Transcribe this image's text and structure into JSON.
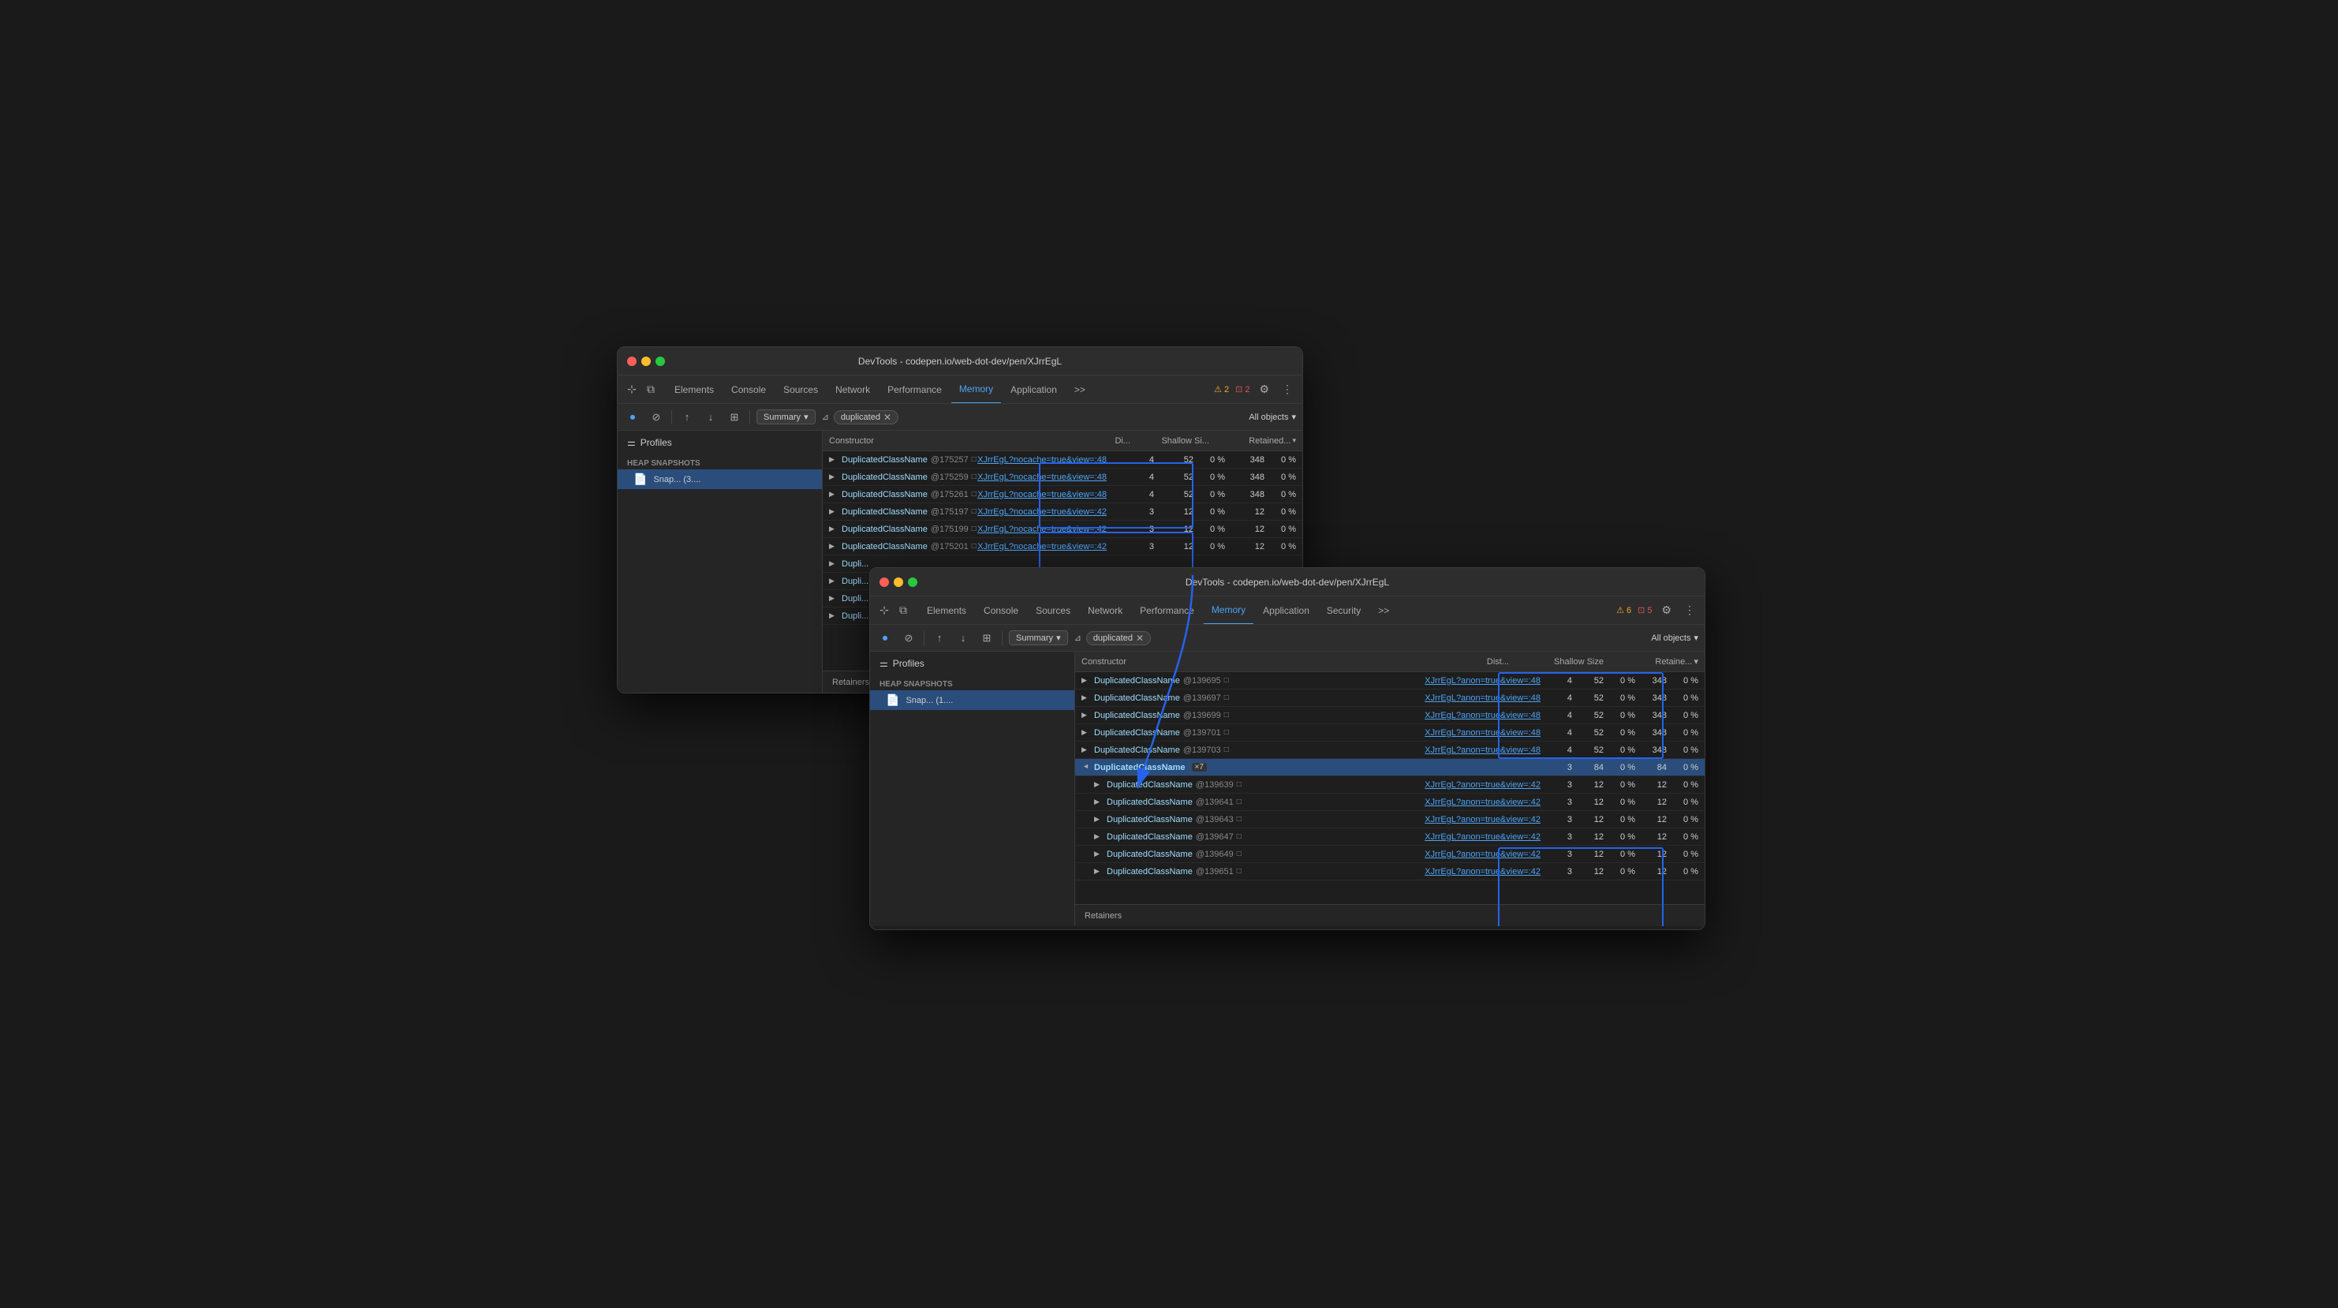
{
  "window1": {
    "title": "DevTools - codepen.io/web-dot-dev/pen/XJrrEgL",
    "tabs": [
      {
        "label": "Elements",
        "active": false
      },
      {
        "label": "Console",
        "active": false
      },
      {
        "label": "Sources",
        "active": false
      },
      {
        "label": "Network",
        "active": false
      },
      {
        "label": "Performance",
        "active": false
      },
      {
        "label": "Memory",
        "active": true
      },
      {
        "label": "Application",
        "active": false
      }
    ],
    "warnings": "2",
    "errors": "2",
    "toolbar": {
      "summary_label": "Summary",
      "filter_label": "duplicated",
      "objects_label": "All objects"
    },
    "sidebar": {
      "profiles_label": "Profiles",
      "heap_snapshots_label": "Heap snapshots",
      "snapshot_item": "Snap... (3...."
    },
    "table": {
      "headers": [
        "Constructor",
        "Di...",
        "Shallow Si...",
        "Retained..."
      ],
      "rows": [
        {
          "class": "DuplicatedClassName",
          "id": "@175257",
          "link": "XJrrEgL?nocache=true&view=:48",
          "dist": "4",
          "shallow": "52",
          "shallow_pct": "0 %",
          "retained": "348",
          "retained_pct": "0 %"
        },
        {
          "class": "DuplicatedClassName",
          "id": "@175259",
          "link": "XJrrEgL?nocache=true&view=:48",
          "dist": "4",
          "shallow": "52",
          "shallow_pct": "0 %",
          "retained": "348",
          "retained_pct": "0 %"
        },
        {
          "class": "DuplicatedClassName",
          "id": "@175261",
          "link": "XJrrEgL?nocache=true&view=:48",
          "dist": "4",
          "shallow": "52",
          "shallow_pct": "0 %",
          "retained": "348",
          "retained_pct": "0 %"
        },
        {
          "class": "DuplicatedClassName",
          "id": "@175197",
          "link": "XJrrEgL?nocache=true&view=:42",
          "dist": "3",
          "shallow": "12",
          "shallow_pct": "0 %",
          "retained": "12",
          "retained_pct": "0 %"
        },
        {
          "class": "DuplicatedClassName",
          "id": "@175199",
          "link": "XJrrEgL?nocache=true&view=:42",
          "dist": "3",
          "shallow": "12",
          "shallow_pct": "0 %",
          "retained": "12",
          "retained_pct": "0 %"
        },
        {
          "class": "DuplicatedClassName",
          "id": "@175201",
          "link": "XJrrEgL?nocache=true&view=:42",
          "dist": "3",
          "shallow": "12",
          "shallow_pct": "0 %",
          "retained": "12",
          "retained_pct": "0 %"
        },
        {
          "class": "Dupli...",
          "id": "",
          "link": "",
          "dist": "",
          "shallow": "",
          "shallow_pct": "",
          "retained": "",
          "retained_pct": ""
        },
        {
          "class": "Dupli...",
          "id": "",
          "link": "",
          "dist": "",
          "shallow": "",
          "shallow_pct": "",
          "retained": "",
          "retained_pct": ""
        },
        {
          "class": "Dupli...",
          "id": "",
          "link": "",
          "dist": "",
          "shallow": "",
          "shallow_pct": "",
          "retained": "",
          "retained_pct": ""
        },
        {
          "class": "Dupli...",
          "id": "",
          "link": "",
          "dist": "",
          "shallow": "",
          "shallow_pct": "",
          "retained": "",
          "retained_pct": ""
        }
      ]
    }
  },
  "window2": {
    "title": "DevTools - codepen.io/web-dot-dev/pen/XJrrEgL",
    "tabs": [
      {
        "label": "Elements",
        "active": false
      },
      {
        "label": "Console",
        "active": false
      },
      {
        "label": "Sources",
        "active": false
      },
      {
        "label": "Network",
        "active": false
      },
      {
        "label": "Performance",
        "active": false
      },
      {
        "label": "Memory",
        "active": true
      },
      {
        "label": "Application",
        "active": false
      },
      {
        "label": "Security",
        "active": false
      }
    ],
    "warnings": "6",
    "errors": "5",
    "toolbar": {
      "summary_label": "Summary",
      "filter_label": "duplicated",
      "objects_label": "All objects"
    },
    "sidebar": {
      "profiles_label": "Profiles",
      "heap_snapshots_label": "Heap snapshots",
      "snapshot_item": "Snap... (1...."
    },
    "table": {
      "headers": [
        "Constructor",
        "Dist...",
        "Shallow Size",
        "Retaine..."
      ],
      "rows": [
        {
          "class": "DuplicatedClassName",
          "id": "@139695",
          "link": "XJrrEgL?anon=true&view=:48",
          "dist": "4",
          "shallow": "52",
          "shallow_pct": "0 %",
          "retained": "348",
          "retained_pct": "0 %"
        },
        {
          "class": "DuplicatedClassName",
          "id": "@139697",
          "link": "XJrrEgL?anon=true&view=:48",
          "dist": "4",
          "shallow": "52",
          "shallow_pct": "0 %",
          "retained": "348",
          "retained_pct": "0 %"
        },
        {
          "class": "DuplicatedClassName",
          "id": "@139699",
          "link": "XJrrEgL?anon=true&view=:48",
          "dist": "4",
          "shallow": "52",
          "shallow_pct": "0 %",
          "retained": "348",
          "retained_pct": "0 %"
        },
        {
          "class": "DuplicatedClassName",
          "id": "@139701",
          "link": "XJrrEgL?anon=true&view=:48",
          "dist": "4",
          "shallow": "52",
          "shallow_pct": "0 %",
          "retained": "348",
          "retained_pct": "0 %"
        },
        {
          "class": "DuplicatedClassName",
          "id": "@139703",
          "link": "XJrrEgL?anon=true&view=:48",
          "dist": "4",
          "shallow": "52",
          "shallow_pct": "0 %",
          "retained": "348",
          "retained_pct": "0 %"
        },
        {
          "class": "DuplicatedClassName",
          "id": "×7",
          "link": "",
          "dist": "3",
          "shallow": "84",
          "shallow_pct": "0 %",
          "retained": "84",
          "retained_pct": "0 %",
          "group": true
        },
        {
          "class": "DuplicatedClassName",
          "id": "@139639",
          "link": "XJrrEgL?anon=true&view=:42",
          "dist": "3",
          "shallow": "12",
          "shallow_pct": "0 %",
          "retained": "12",
          "retained_pct": "0 %"
        },
        {
          "class": "DuplicatedClassName",
          "id": "@139641",
          "link": "XJrrEgL?anon=true&view=:42",
          "dist": "3",
          "shallow": "12",
          "shallow_pct": "0 %",
          "retained": "12",
          "retained_pct": "0 %"
        },
        {
          "class": "DuplicatedClassName",
          "id": "@139643",
          "link": "XJrrEgL?anon=true&view=:42",
          "dist": "3",
          "shallow": "12",
          "shallow_pct": "0 %",
          "retained": "12",
          "retained_pct": "0 %"
        },
        {
          "class": "DuplicatedClassName",
          "id": "@139647",
          "link": "XJrrEgL?anon=true&view=:42",
          "dist": "3",
          "shallow": "12",
          "shallow_pct": "0 %",
          "retained": "12",
          "retained_pct": "0 %"
        },
        {
          "class": "DuplicatedClassName",
          "id": "@139649",
          "link": "XJrrEgL?anon=true&view=:42",
          "dist": "3",
          "shallow": "12",
          "shallow_pct": "0 %",
          "retained": "12",
          "retained_pct": "0 %"
        },
        {
          "class": "DuplicatedClassName",
          "id": "@139651",
          "link": "XJrrEgL?anon=true&view=:42",
          "dist": "3",
          "shallow": "12",
          "shallow_pct": "0 %",
          "retained": "12",
          "retained_pct": "0 %"
        }
      ]
    }
  },
  "icons": {
    "cursor": "⊹",
    "layers": "⧉",
    "record": "⏺",
    "stop": "⊘",
    "upload": "↑",
    "download": "↓",
    "grid": "⊞",
    "filter": "⊿",
    "chevron": "▾",
    "expand": "▶",
    "collapse": "▼",
    "warning": "⚠",
    "error": "⊡",
    "gear": "⚙",
    "more": "⋮",
    "snapshot": "📄",
    "equalizer": "⚌"
  }
}
